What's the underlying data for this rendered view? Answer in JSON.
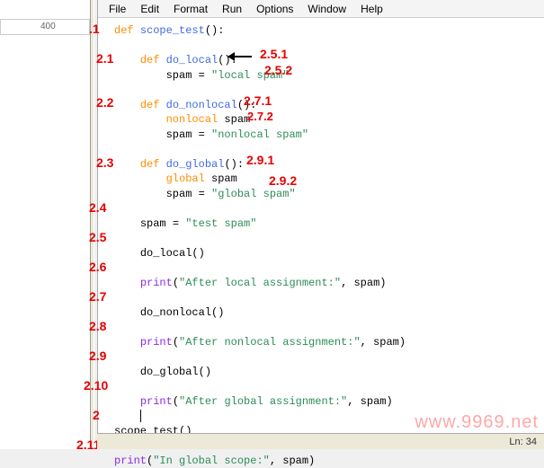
{
  "ruler": {
    "tick": "400"
  },
  "menu": {
    "file": "File",
    "edit": "Edit",
    "format": "Format",
    "run": "Run",
    "options": "Options",
    "window": "Window",
    "help": "Help"
  },
  "code": {
    "l1_def": "def",
    "l1_fn": "scope_test",
    "l1_rest": "():",
    "l2_def": "def",
    "l2_fn": "do_local",
    "l2_rest": "():",
    "l3_var": "spam = ",
    "l3_str": "\"local spam\"",
    "l4_def": "def",
    "l4_fn": "do_nonlocal",
    "l4_rest": "():",
    "l5_kw": "nonlocal",
    "l5_var": " spam",
    "l6_var": "spam = ",
    "l6_str": "\"nonlocal spam\"",
    "l7_def": "def",
    "l7_fn": "do_global",
    "l7_rest": "():",
    "l8_kw": "global",
    "l8_var": " spam",
    "l9_var": "spam = ",
    "l9_str": "\"global spam\"",
    "l10_var": "spam = ",
    "l10_str": "\"test spam\"",
    "l11": "do_local()",
    "l12_pf": "print",
    "l12_open": "(",
    "l12_str": "\"After local assignment:\"",
    "l12_rest": ", spam)",
    "l13": "do_nonlocal()",
    "l14_pf": "print",
    "l14_open": "(",
    "l14_str": "\"After nonlocal assignment:\"",
    "l14_rest": ", spam)",
    "l15": "do_global()",
    "l16_pf": "print",
    "l16_open": "(",
    "l16_str": "\"After global assignment:\"",
    "l16_rest": ", spam)",
    "l17": "scope_test()",
    "l18_pf": "print",
    "l18_open": "(",
    "l18_str": "\"In global scope:\"",
    "l18_rest": ", spam)"
  },
  "annotations": {
    "a1": ".1",
    "a21": "2.1",
    "a22": "2.2",
    "a23": "2.3",
    "a24": "2.4",
    "a25": "2.5",
    "a26": "2.6",
    "a27": "2.7",
    "a28": "2.8",
    "a29": "2.9",
    "a210": "2.10",
    "a2": "2",
    "a211": "2.11",
    "a251": "2.5.1",
    "a252": "2.5.2",
    "a271": "2.7.1",
    "a272": "2.7.2",
    "a291": "2.9.1",
    "a292": "2.9.2"
  },
  "status": {
    "line": "Ln: 34"
  },
  "watermark": "www.9969.net"
}
